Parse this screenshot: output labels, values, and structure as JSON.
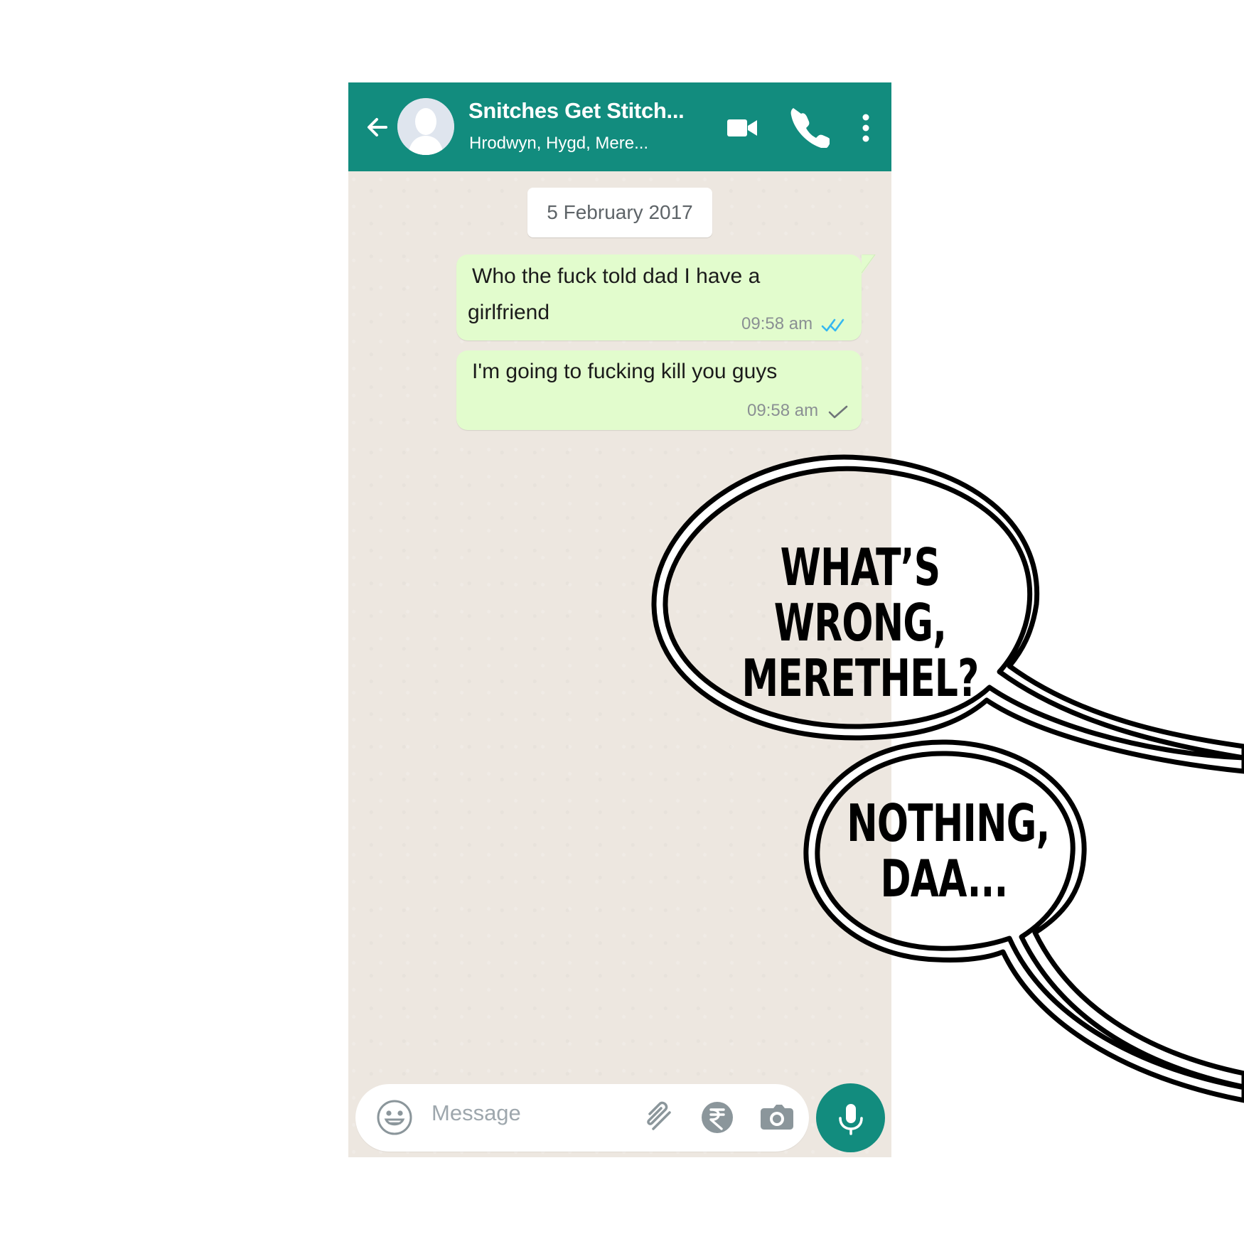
{
  "chat_header": {
    "title": "Snitches Get Stitch...",
    "subtitle": "Hrodwyn, Hygd, Mere...",
    "back_icon": "arrow-left-icon",
    "avatar": "group-avatar-placeholder",
    "actions": {
      "video_icon": "video-call-icon",
      "call_icon": "voice-call-icon",
      "more_icon": "more-vertical-icon"
    }
  },
  "conversation": {
    "date": "5 February 2017",
    "messages": [
      {
        "text_lines": [
          "Who the fuck told dad I have a",
          "girlfriend"
        ],
        "time": "09:58 am",
        "status_icon": "double-check-icon"
      },
      {
        "text": "I'm going to fucking kill you guys",
        "time": "09:58 am",
        "status_icon": "single-check-icon"
      }
    ]
  },
  "composer": {
    "placeholder": "Message",
    "emoji_icon": "emoji-icon",
    "attach_icon": "paperclip-icon",
    "payment_icon": "rupee-icon",
    "camera_icon": "camera-icon",
    "mic_icon": "microphone-icon"
  },
  "comic_bubbles": [
    "WHAT’S WRONG, MERETHEL?",
    "NOTHING, DAA..."
  ],
  "colors": {
    "header": "#128c7e",
    "outgoing_bubble": "#e2fccd",
    "chat_background": "#ede7e0",
    "read_tick": "#34b7f1"
  }
}
